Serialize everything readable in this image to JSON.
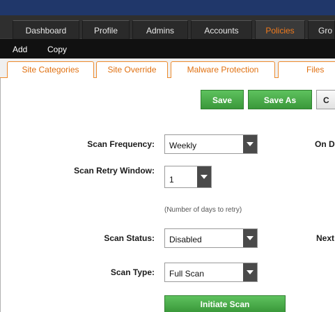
{
  "nav": {
    "items": [
      {
        "label": "Dashboard"
      },
      {
        "label": "Profile"
      },
      {
        "label": "Admins"
      },
      {
        "label": "Accounts"
      },
      {
        "label": "Policies"
      },
      {
        "label": "Gro"
      }
    ],
    "active": "Policies"
  },
  "subnav": {
    "items": [
      {
        "label": "Add"
      },
      {
        "label": "Copy"
      }
    ]
  },
  "tabs": [
    {
      "label": "Site Categories"
    },
    {
      "label": "Site Override"
    },
    {
      "label": "Malware Protection"
    },
    {
      "label": "Files"
    }
  ],
  "toolbar": {
    "save_label": "Save",
    "save_as_label": "Save As",
    "third_label": "C"
  },
  "form": {
    "scan_frequency": {
      "label": "Scan Frequency:",
      "value": "Weekly"
    },
    "on_label": "On D",
    "scan_retry_window": {
      "label": "Scan Retry Window:",
      "value": "1",
      "hint": "(Number of days to retry)"
    },
    "scan_status": {
      "label": "Scan Status:",
      "value": "Disabled"
    },
    "next_label": "Next",
    "scan_type": {
      "label": "Scan Type:",
      "value": "Full Scan"
    },
    "initiate_label": "Initiate Scan"
  },
  "colors": {
    "nav_bg": "#2f2f2f",
    "active_tab": "#f07a1d",
    "tab_text": "#e07010",
    "green_button": "#4caf4c"
  }
}
